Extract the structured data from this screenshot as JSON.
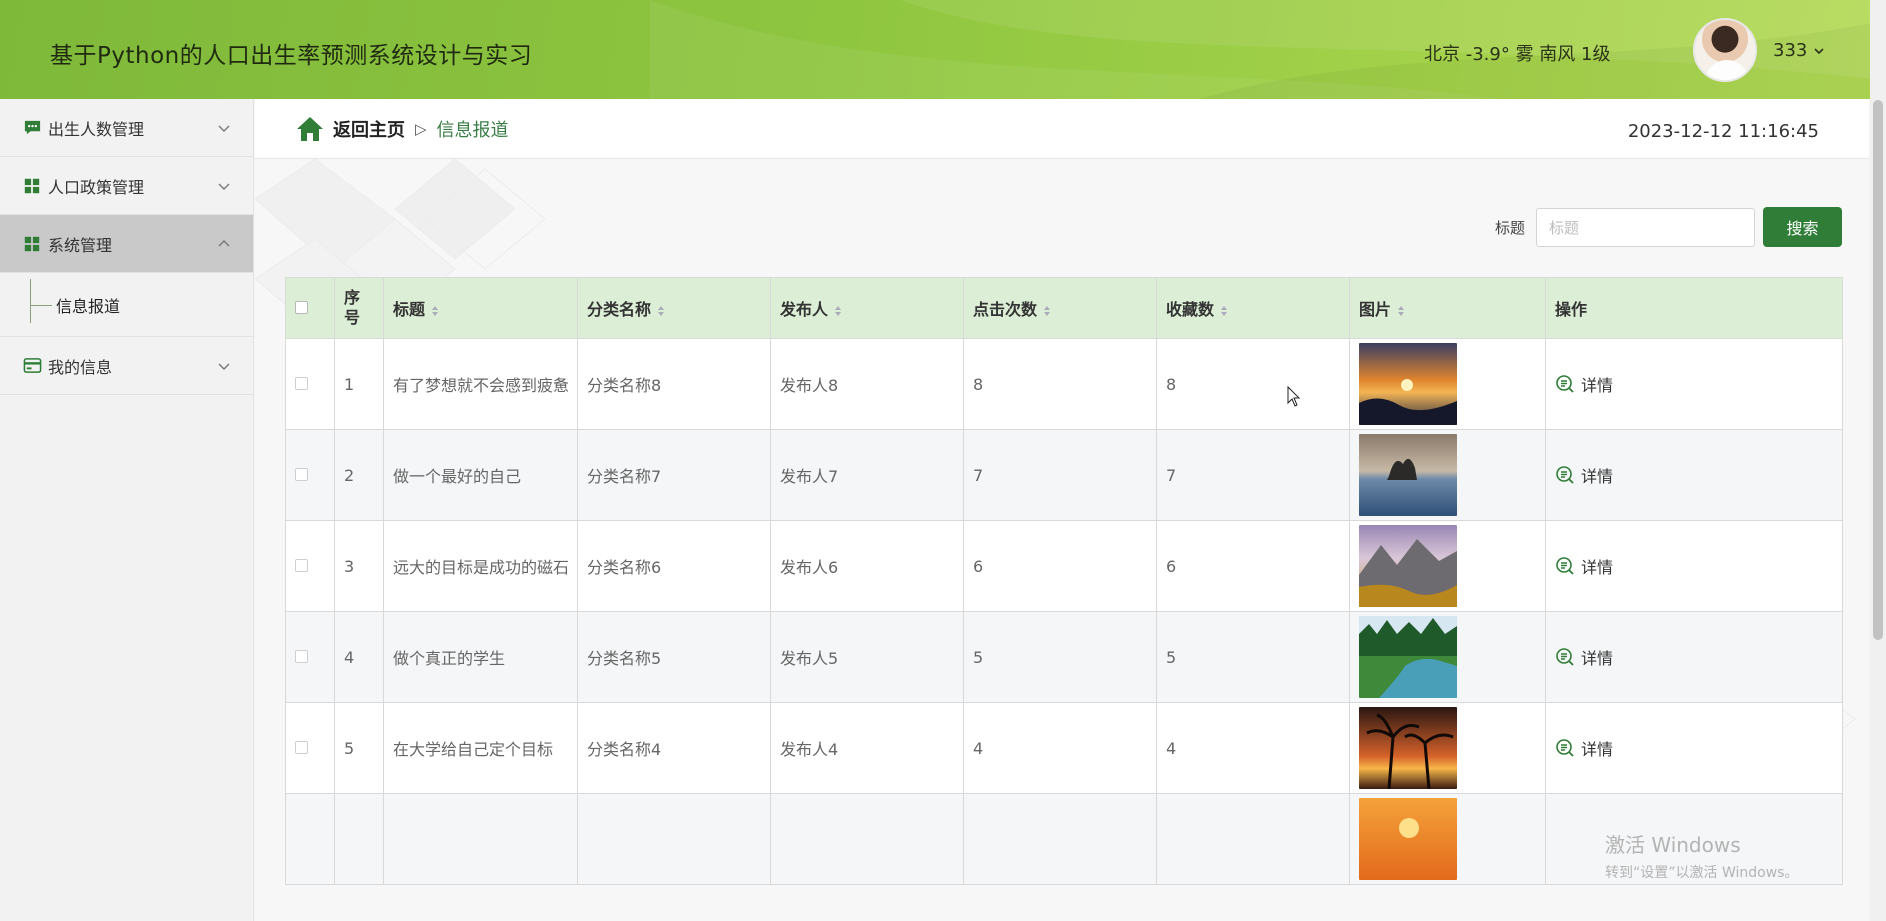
{
  "header": {
    "app_title": "基于Python的人口出生率预测系统设计与实习",
    "weather": "北京  -3.9°  雾  南风  1级",
    "user_name": "333"
  },
  "sidebar": {
    "items": [
      {
        "label": "出生人数管理",
        "icon": "chat-icon",
        "expanded": false
      },
      {
        "label": "人口政策管理",
        "icon": "grid-icon",
        "expanded": false
      },
      {
        "label": "系统管理",
        "icon": "grid-icon",
        "expanded": true,
        "active": true
      },
      {
        "label": "我的信息",
        "icon": "card-icon",
        "expanded": false
      }
    ],
    "sub_items": [
      {
        "label": "信息报道",
        "parent": "系统管理"
      }
    ]
  },
  "breadcrumb": {
    "home_label": "返回主页",
    "separator": "▷",
    "current": "信息报道"
  },
  "datetime": "2023-12-12 11:16:45",
  "search": {
    "label": "标题",
    "placeholder": "标题",
    "value": "",
    "button_label": "搜索"
  },
  "table": {
    "headers": {
      "index": "序号",
      "title": "标题",
      "category": "分类名称",
      "publisher": "发布人",
      "clicks": "点击次数",
      "favorites": "收藏数",
      "image": "图片",
      "actions": "操作"
    },
    "detail_label": "详情",
    "rows": [
      {
        "index": "1",
        "title": "有了梦想就不会感到疲惫",
        "category": "分类名称8",
        "publisher": "发布人8",
        "clicks": "8",
        "favorites": "8",
        "image": "sunset-sea-image"
      },
      {
        "index": "2",
        "title": "做一个最好的自己",
        "category": "分类名称7",
        "publisher": "发布人7",
        "clicks": "7",
        "favorites": "7",
        "image": "lake-tree-image"
      },
      {
        "index": "3",
        "title": "远大的目标是成功的磁石",
        "category": "分类名称6",
        "publisher": "发布人6",
        "clicks": "6",
        "favorites": "6",
        "image": "mountain-valley-image"
      },
      {
        "index": "4",
        "title": "做个真正的学生",
        "category": "分类名称5",
        "publisher": "发布人5",
        "clicks": "5",
        "favorites": "5",
        "image": "forest-river-image"
      },
      {
        "index": "5",
        "title": "在大学给自己定个目标",
        "category": "分类名称4",
        "publisher": "发布人4",
        "clicks": "4",
        "favorites": "4",
        "image": "palm-sunset-image"
      },
      {
        "index": "",
        "title": "",
        "category": "",
        "publisher": "",
        "clicks": "",
        "favorites": "",
        "image": "orange-sunset-image"
      }
    ]
  },
  "watermark": {
    "line1": "激活 Windows",
    "line2": "转到“设置”以激活 Windows。"
  },
  "colors": {
    "brand_green": "#2f7d36",
    "header_green": "#8fc640",
    "table_header_bg": "#dcefd6",
    "sidebar_active_bg": "#c9c9c9"
  }
}
